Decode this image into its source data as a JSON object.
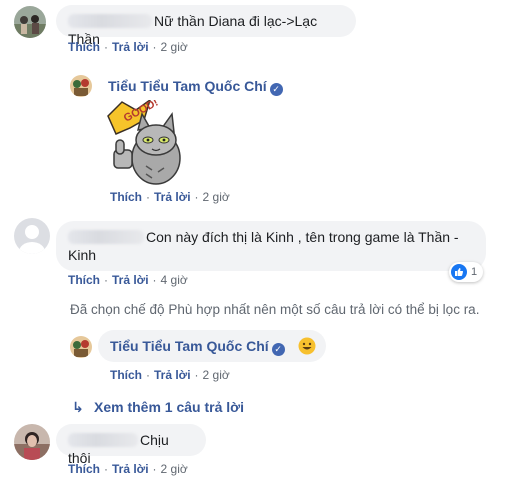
{
  "colors": {
    "link": "#385898",
    "meta": "#606770",
    "bubble": "#f2f3f5",
    "verified": "#4267b2",
    "like_blue": "#1877f2"
  },
  "actions": {
    "like": "Thích",
    "reply": "Trả lời",
    "separator": "·"
  },
  "comments": [
    {
      "text": "Nữ thần Diana đi lạc->Lạc Thần",
      "time": "2 giờ",
      "reply": {
        "author": "Tiểu Tiểu Tam Quốc Chí",
        "verified": true,
        "sticker": "good-cat-thumbs-up-sticker",
        "sticker_text": "GOOD!",
        "time": "2 giờ"
      }
    },
    {
      "text_line1": "Con này đích thị là Kinh , tên trong game là Thần -",
      "text_line2": "Kinh",
      "time": "4 giờ",
      "reaction_count": "1",
      "notice": "Đã chọn chế độ Phù hợp nhất nên một số câu trả lời có thể bị lọc ra.",
      "reply": {
        "author": "Tiểu Tiểu Tam Quốc Chí",
        "verified": true,
        "emoji": "grinning-face-icon",
        "time": "2 giờ"
      },
      "more_replies": "Xem thêm 1 câu trả lời"
    },
    {
      "text": "Chịu thôi",
      "time": "2 giờ"
    }
  ]
}
